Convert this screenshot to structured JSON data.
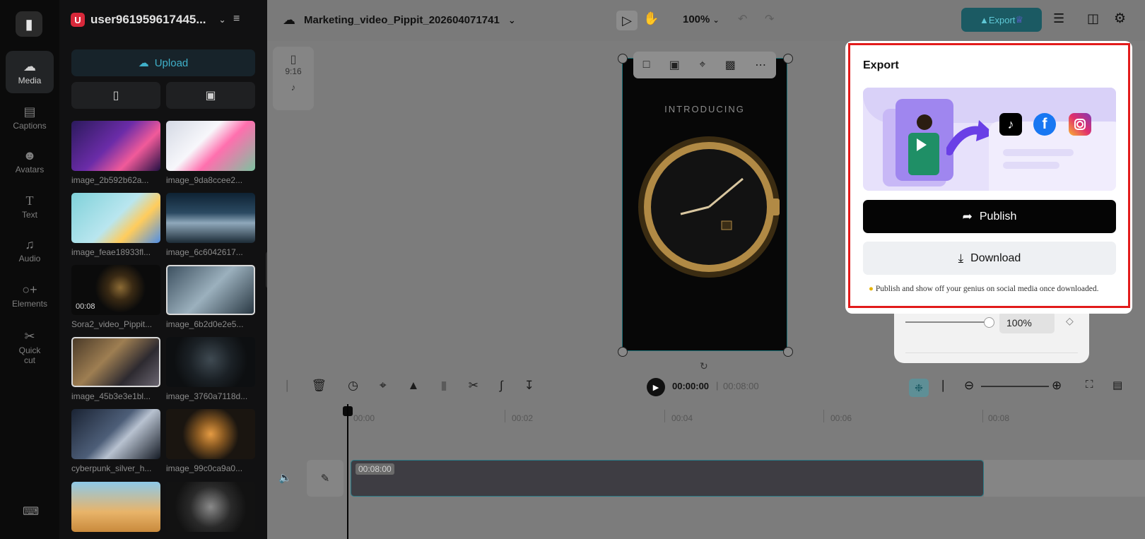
{
  "rail": {
    "items": [
      {
        "label": "Media",
        "icon": "cloud-icon",
        "active": true
      },
      {
        "label": "Captions",
        "icon": "captions-icon"
      },
      {
        "label": "Avatars",
        "icon": "avatar-icon"
      },
      {
        "label": "Text",
        "icon": "text-icon"
      },
      {
        "label": "Audio",
        "icon": "music-note-icon"
      },
      {
        "label": "Elements",
        "icon": "elements-icon"
      },
      {
        "label": "Quick cut",
        "icon": "scissors-icon"
      }
    ]
  },
  "user": {
    "badge": "U",
    "name": "user961959617445..."
  },
  "media": {
    "upload_label": "Upload",
    "items": [
      {
        "label": "image_2b592b62a..."
      },
      {
        "label": "image_9da8ccee2..."
      },
      {
        "label": "image_feae18933fl..."
      },
      {
        "label": "image_6c6042617..."
      },
      {
        "label": "Sora2_video_Pippit...",
        "duration": "00:08"
      },
      {
        "label": "image_6b2d0e2e5..."
      },
      {
        "label": "image_45b3e3e1bl..."
      },
      {
        "label": "image_3760a7118d..."
      },
      {
        "label": "cyberpunk_silver_h..."
      },
      {
        "label": "image_99c0ca9a0..."
      }
    ]
  },
  "header": {
    "project_name": "Marketing_video_Pippit_202604071741",
    "zoom": "100%",
    "export_label": "Export"
  },
  "ratio_card": {
    "ratio": "9:16"
  },
  "canvas": {
    "video_text": "INTRODUCING"
  },
  "timeline": {
    "current_time": "00:00:00",
    "total_time": "00:08:00",
    "ruler": [
      "00:00",
      "00:02",
      "00:04",
      "00:06",
      "00:08"
    ],
    "clip_duration": "00:08:00"
  },
  "opacity_panel": {
    "value": "100%"
  },
  "export_popup": {
    "title": "Export",
    "publish_label": "Publish",
    "download_label": "Download",
    "tip": "Publish and show off your genius on social media once downloaded."
  },
  "colors": {
    "accent": "#3fb0c9",
    "highlight": "#e21b1b"
  }
}
